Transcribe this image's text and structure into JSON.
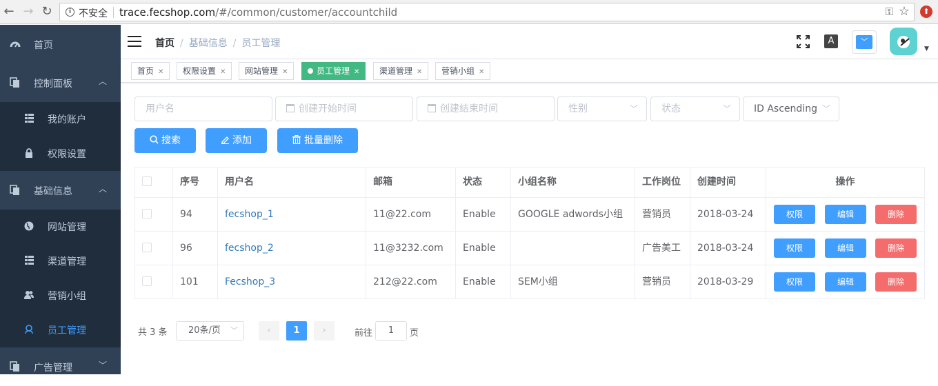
{
  "browser": {
    "back": "←",
    "forward": "→",
    "reload": "↻",
    "security": "不安全",
    "url_host": "trace.fecshop.com",
    "url_path": "/#/common/customer/accountchild"
  },
  "sidebar": {
    "items": [
      {
        "label": "首页",
        "icon": "dashboard-icon"
      },
      {
        "label": "控制面板",
        "icon": "documents-icon",
        "expanded": true
      },
      {
        "label": "我的账户",
        "icon": "grid-icon"
      },
      {
        "label": "权限设置",
        "icon": "lock-icon"
      },
      {
        "label": "基础信息",
        "icon": "documents-icon",
        "expanded": true
      },
      {
        "label": "网站管理",
        "icon": "globe-icon"
      },
      {
        "label": "渠道管理",
        "icon": "grid-icon"
      },
      {
        "label": "营销小组",
        "icon": "users-icon"
      },
      {
        "label": "员工管理",
        "icon": "user-badge-icon",
        "active": true
      },
      {
        "label": "广告管理",
        "icon": "documents-icon",
        "expanded": false
      }
    ],
    "colors": {
      "background": "#304156",
      "submenu_background": "#1f2d3d",
      "text": "#bfcbd9",
      "active": "#409eff"
    }
  },
  "breadcrumb": {
    "home": "首页",
    "level1": "基础信息",
    "level2": "员工管理",
    "separator": "/"
  },
  "navbar": {
    "translate_label": "A"
  },
  "tags": [
    {
      "label": "首页",
      "active": false
    },
    {
      "label": "权限设置",
      "active": false
    },
    {
      "label": "网站管理",
      "active": false
    },
    {
      "label": "员工管理",
      "active": true
    },
    {
      "label": "渠道管理",
      "active": false
    },
    {
      "label": "营销小组",
      "active": false
    }
  ],
  "filters": {
    "username_placeholder": "用户名",
    "created_start_placeholder": "创建开始时间",
    "created_end_placeholder": "创建结束时间",
    "gender_placeholder": "性别",
    "status_placeholder": "状态",
    "sort_value": "ID Ascending"
  },
  "actions": {
    "search": "搜索",
    "add": "添加",
    "batch_delete": "批量删除"
  },
  "table": {
    "headers": [
      "序号",
      "用户名",
      "邮箱",
      "状态",
      "小组名称",
      "工作岗位",
      "创建时间",
      "操作"
    ],
    "rows": [
      {
        "id": "94",
        "username": "fecshop_1",
        "email": "11@22.com",
        "status": "Enable",
        "group": "GOOGLE adwords小组",
        "position": "营销员",
        "created": "2018-03-24"
      },
      {
        "id": "96",
        "username": "fecshop_2",
        "email": "11@3232.com",
        "status": "Enable",
        "group": "",
        "position": "广告美工",
        "created": "2018-03-24"
      },
      {
        "id": "101",
        "username": "Fecshop_3",
        "email": "212@22.com",
        "status": "Enable",
        "group": "SEM小组",
        "position": "营销员",
        "created": "2018-03-29"
      }
    ],
    "row_actions": {
      "permission": "权限",
      "edit": "编辑",
      "delete": "删除"
    }
  },
  "pagination": {
    "total": "共 3 条",
    "page_size": "20条/页",
    "current_page": "1",
    "goto_label": "前往",
    "goto_value": "1",
    "page_suffix": "页"
  },
  "colors": {
    "primary": "#409eff",
    "danger": "#f56c6c",
    "tag_active": "#42b983"
  }
}
